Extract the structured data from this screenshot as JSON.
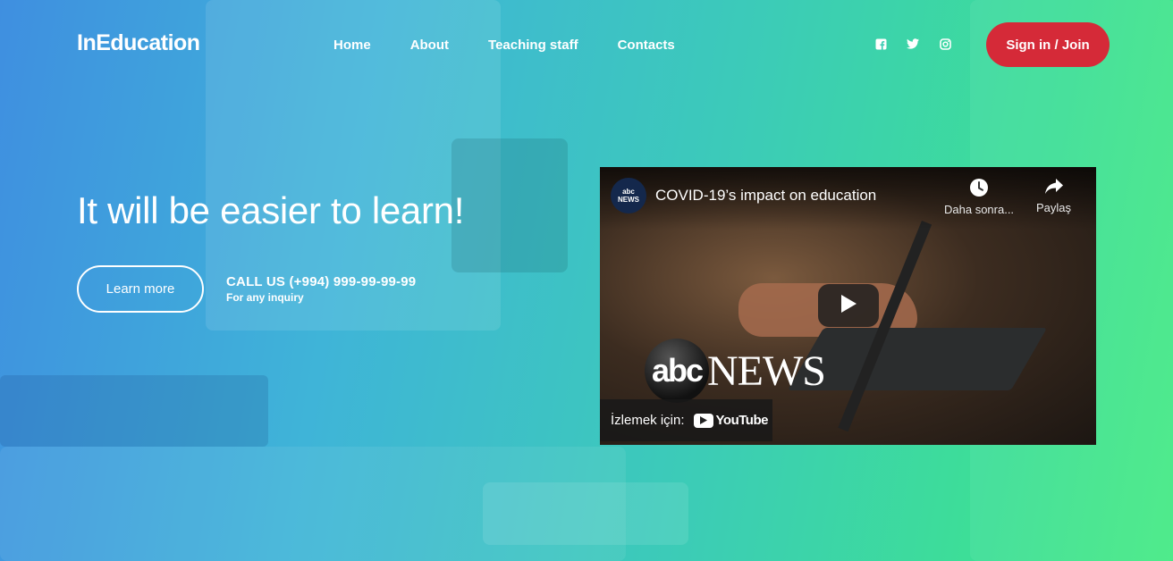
{
  "header": {
    "logo": "InEducation",
    "nav": [
      "Home",
      "About",
      "Teaching staff",
      "Contacts"
    ],
    "social_icons": [
      "facebook-icon",
      "twitter-icon",
      "instagram-icon"
    ],
    "signin_label": "Sign in / Join"
  },
  "hero": {
    "title": "It will be easier to learn!",
    "learn_more": "Learn more",
    "call_us": "CALL US (+994) 999-99-99-99",
    "call_sub": "For any inquiry"
  },
  "video": {
    "channel_avatar_text": [
      "abc",
      "NEWS"
    ],
    "title": "COVID-19’s impact on education",
    "watch_later": "Daha sonra...",
    "share": "Paylaş",
    "watch_on": "İzlemek için:",
    "youtube": "YouTube",
    "thumb_logo_abc": "abc",
    "thumb_logo_news": "NEWS"
  },
  "colors": {
    "signin_bg": "#d52a38",
    "gradient_start": "#3f8fe0",
    "gradient_end": "#45ea84"
  }
}
